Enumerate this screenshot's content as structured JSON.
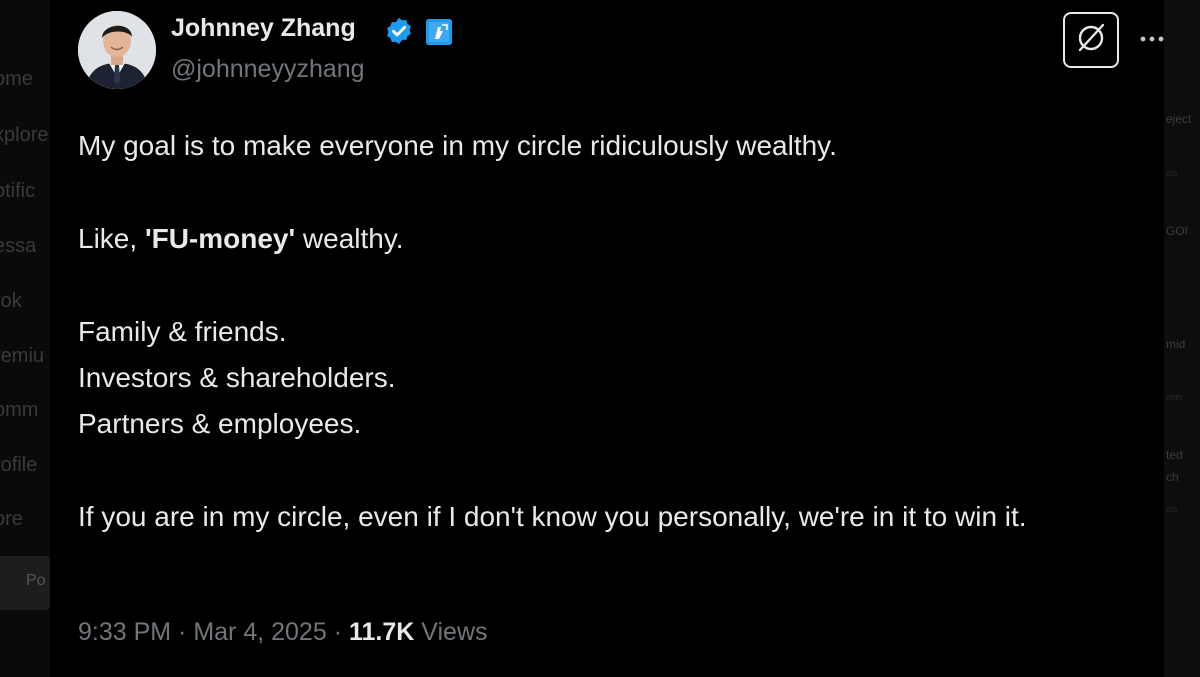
{
  "background": {
    "sidebar_items": [
      "ome",
      "xplore",
      "otific",
      "essa",
      "rok",
      "remiu",
      "omm",
      "rofile",
      "ore"
    ],
    "post_label": "Po",
    "right_items": [
      "eject",
      "GOI",
      "mid",
      "ted",
      "ch"
    ]
  },
  "tweet": {
    "author_name": "Johnney Zhang",
    "handle": "@johnneyyzhang",
    "line1": "My goal is to make everyone in my circle ridiculously wealthy.",
    "line2_prefix": "Like, ",
    "line2_bold": "'FU-money'",
    "line2_suffix": " wealthy.",
    "line3": "Family & friends.",
    "line4": "Investors & shareholders.",
    "line5": "Partners & employees.",
    "line6": "If you are in my circle, even if I don't know you personally, we're in it to win it.",
    "time": "9:33 PM",
    "separator": " · ",
    "date": "Mar 4, 2025",
    "views_count": "11.7K",
    "views_label": " Views"
  },
  "icons": {
    "verified": "verified-check-icon",
    "affiliate": "affiliate-badge-icon",
    "grok": "grok-icon",
    "more": "more-dots-icon"
  },
  "colors": {
    "background": "#000000",
    "text": "#e7e9ea",
    "muted": "#71767b",
    "verified_blue": "#1d9bf0"
  }
}
